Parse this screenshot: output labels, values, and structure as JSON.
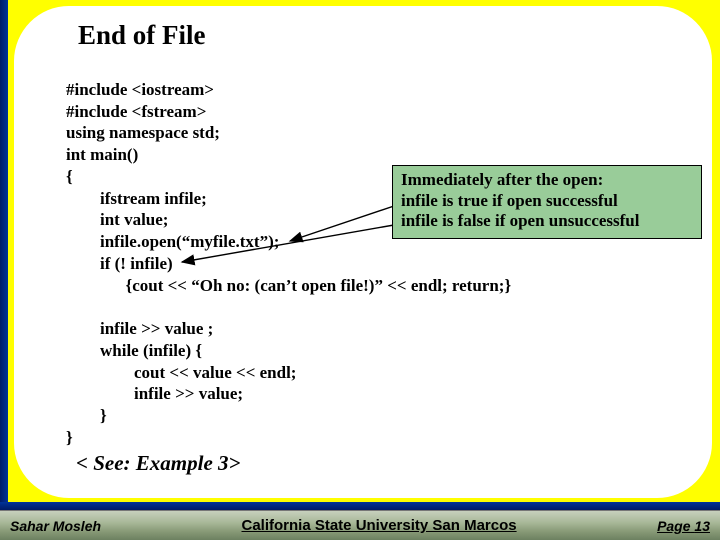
{
  "title": "End of File",
  "code": {
    "l1": "#include <iostream>",
    "l2": "#include <fstream>",
    "l3": "using namespace std;",
    "l4": "int main()",
    "l5": "{",
    "l6": "        ifstream infile;",
    "l7": "        int value;",
    "l8": "        infile.open(“myfile.txt”);",
    "l9": "        if (! infile)",
    "l10": "              {cout << “Oh no: (can’t open file!)” << endl; return;}",
    "blank1": "",
    "l11": "        infile >> value ;",
    "l12": "        while (infile) {",
    "l13": "                cout << value << endl;",
    "l14": "                infile >> value;",
    "l15": "        }",
    "l16": "}"
  },
  "callout": {
    "line1": "Immediately after the open:",
    "line2": "infile is true if open successful",
    "line3": "infile is false if open unsuccessful"
  },
  "see": "< See: Example 3>",
  "footer": {
    "left": "Sahar Mosleh",
    "center": "California State University San Marcos",
    "right_label": "Page",
    "right_num": "13"
  }
}
